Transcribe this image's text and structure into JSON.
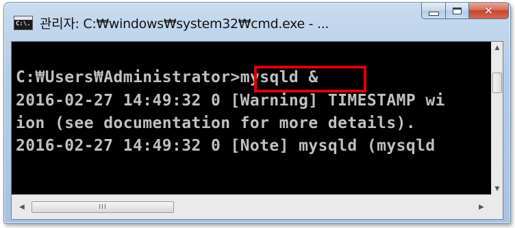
{
  "window": {
    "icon_text": "C:\\.",
    "title": "관리자: C:₩windows₩system32₩cmd.exe - ...",
    "minimize_glyph": "",
    "close_glyph": "✕"
  },
  "console": {
    "lines": [
      {
        "prompt": "C:₩Users₩Administrator",
        "command": ">mysqld &"
      },
      {
        "text": "2016-02-27 14:49:32 0 [Warning] TIMESTAMP wi"
      },
      {
        "text": "ion (see documentation for more details)."
      },
      {
        "text": "2016-02-27 14:49:32 0 [Note] mysqld (mysqld"
      }
    ],
    "text_color": "#c0c0c0",
    "background": "#000000",
    "highlight_color": "#e00000"
  },
  "scrollbars": {
    "up_arrow": "▲",
    "down_arrow": "▼",
    "left_arrow": "◀",
    "right_arrow": "▶",
    "h_grip": "III"
  }
}
